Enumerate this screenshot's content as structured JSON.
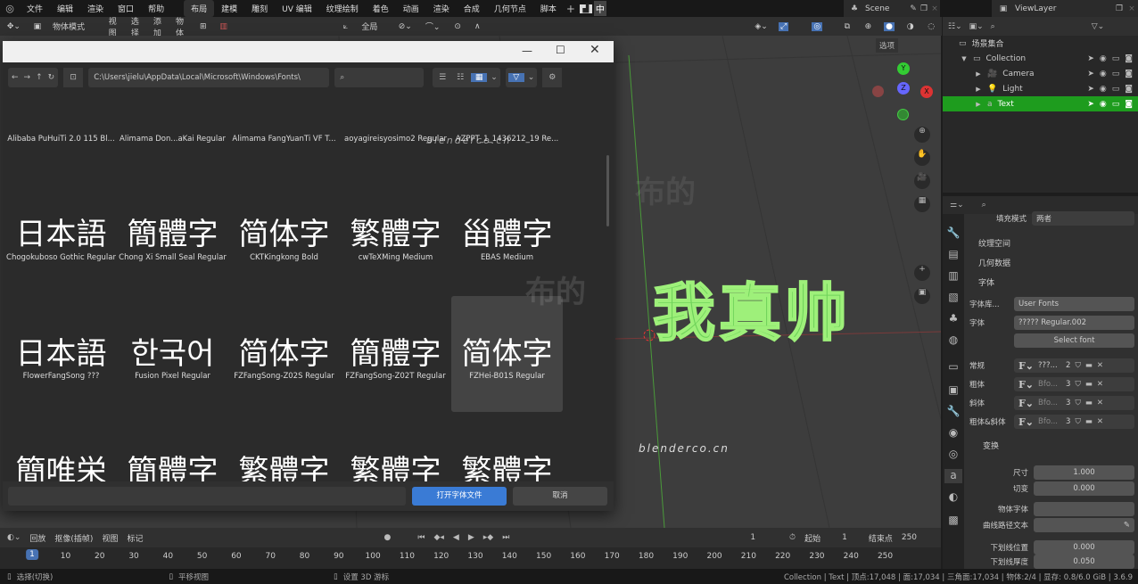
{
  "topbar": {
    "menus": [
      "文件",
      "编辑",
      "渲染",
      "窗口",
      "帮助"
    ],
    "workspaces": [
      "布局",
      "建模",
      "雕刻",
      "UV 编辑",
      "纹理绘制",
      "着色",
      "动画",
      "渲染",
      "合成",
      "几何节点",
      "脚本"
    ],
    "active_workspace": "布局",
    "scene": "Scene",
    "view_layer": "ViewLayer",
    "ime": "中"
  },
  "header": {
    "mode": "物体模式",
    "menus": [
      "视图",
      "选择",
      "添加",
      "物体"
    ],
    "transform_orientation": "全局",
    "options": "选项"
  },
  "dialog": {
    "path": "C:\\Users\\jielu\\AppData\\Local\\Microsoft\\Windows\\Fonts\\",
    "search_placeholder": "",
    "filename": "",
    "open_button": "打开字体文件",
    "cancel_button": "取消",
    "fonts": [
      {
        "label": "Alibaba PuHuiTi 2.0 115 Bl...",
        "preview": ""
      },
      {
        "label": "Alimama Don...aKai Regular",
        "preview": ""
      },
      {
        "label": "Alimama FangYuanTi VF T...",
        "preview": ""
      },
      {
        "label": "aoyagireisyosimo2 Regular",
        "preview": ""
      },
      {
        "label": "AZPPT_1_1436212_19 Re...",
        "preview": ""
      },
      {
        "label": "Chogokuboso Gothic Regular",
        "preview": "日本語"
      },
      {
        "label": "Chong Xi Small Seal Regular",
        "preview": "簡體字"
      },
      {
        "label": "CKTKingkong Bold",
        "preview": "简体字"
      },
      {
        "label": "cwTeXMing Medium",
        "preview": "繁體字"
      },
      {
        "label": "EBAS Medium",
        "preview": "甾體字"
      },
      {
        "label": "FlowerFangSong ???",
        "preview": "日本語"
      },
      {
        "label": "Fusion Pixel Regular",
        "preview": "한국어"
      },
      {
        "label": "FZFangSong-Z02S Regular",
        "preview": "简体字"
      },
      {
        "label": "FZFangSong-Z02T Regular",
        "preview": "簡體字"
      },
      {
        "label": "FZHei-B01S Regular",
        "preview": "简体字"
      },
      {
        "label": "",
        "preview": "簡唯栄"
      },
      {
        "label": "",
        "preview": "簡體字"
      },
      {
        "label": "",
        "preview": "繁體字"
      },
      {
        "label": "",
        "preview": "繁體字"
      },
      {
        "label": "",
        "preview": "繁體字"
      }
    ],
    "selected_index": 14
  },
  "viewport": {
    "text_object": "我真帅",
    "text_color": "#6fd25a",
    "watermarks": [
      "布的",
      "blenderco.cn"
    ],
    "gizmo": {
      "x": "X",
      "y": "Y",
      "z": "Z"
    }
  },
  "outliner": {
    "root": "场景集合",
    "items": [
      {
        "label": "Collection"
      },
      {
        "label": "Camera"
      },
      {
        "label": "Light"
      },
      {
        "label": "Text",
        "selected": true
      }
    ]
  },
  "properties": {
    "fill_mode_label": "填充模式",
    "fill_mode": "两者",
    "sections": {
      "texture_space": "纹理空间",
      "geometry": "几何数据",
      "font": "字体",
      "transform": "变换"
    },
    "font_library_label": "字体库...",
    "font_library": "User Fonts",
    "font_label": "字体",
    "font_value": "????? Regular.002",
    "select_font": "Select font",
    "styles": [
      {
        "label": "常规",
        "name": "???...",
        "users": "2"
      },
      {
        "label": "粗体",
        "name": "Bfo...",
        "users": "3"
      },
      {
        "label": "斜体",
        "name": "Bfo...",
        "users": "3"
      },
      {
        "label": "粗体&斜体",
        "name": "Bfo...",
        "users": "3"
      }
    ],
    "size_label": "尺寸",
    "size": "1.000",
    "shear_label": "切变",
    "shear": "0.000",
    "object_font_label": "物体字体",
    "text_on_curve_label": "曲线路径文本",
    "underline_pos_label": "下划线位置",
    "underline_pos": "0.000",
    "underline_thick_label": "下划线厚度",
    "underline_thick": "0.050"
  },
  "timeline": {
    "menus": [
      "回放",
      "抠像(插帧)",
      "视图",
      "标记"
    ],
    "current_frame": "1",
    "start_label": "起始",
    "start": "1",
    "end_label": "结束点",
    "end": "250",
    "ticks": [
      "1",
      "10",
      "20",
      "30",
      "40",
      "50",
      "60",
      "70",
      "80",
      "90",
      "100",
      "110",
      "120",
      "130",
      "140",
      "150",
      "160",
      "170",
      "180",
      "190",
      "200",
      "210",
      "220",
      "230",
      "240",
      "250"
    ]
  },
  "status": {
    "left": [
      {
        "label": "选择(切换)"
      },
      {
        "label": "平移视图"
      },
      {
        "label": "设置 3D 游标"
      }
    ],
    "right": "Collection | Text | 顶点:17,048 | 面:17,034 | 三角面:17,034 | 物体:2/4 | 显存: 0.8/6.0 GiB | 3.6.9"
  },
  "colors": {
    "accent": "#4772b3",
    "selected_row": "#1e9c1e",
    "button_blue": "#3a7bd5"
  }
}
